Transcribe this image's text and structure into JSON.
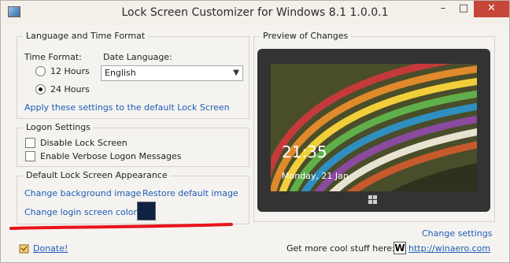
{
  "window": {
    "title": "Lock Screen Customizer for Windows 8.1 1.0.0.1",
    "minimize_glyph": "–",
    "maximize_glyph": "□",
    "close_glyph": "✕"
  },
  "language_time": {
    "group_title": "Language and Time Format",
    "time_format_label": "Time Format:",
    "options": [
      "12 Hours",
      "24 Hours"
    ],
    "selected_time_format": "24 Hours",
    "date_language_label": "Date Language:",
    "date_language_value": "English",
    "apply_link": "Apply these settings to the default Lock Screen"
  },
  "logon": {
    "group_title": "Logon Settings",
    "disable_lock_screen": "Disable Lock Screen",
    "disable_lock_screen_checked": false,
    "verbose_messages": "Enable Verbose Logon Messages",
    "verbose_messages_checked": false
  },
  "appearance": {
    "group_title": "Default Lock Screen Appearance",
    "change_background": "Change background image",
    "restore_default": "Restore default image",
    "change_login_color": "Change login screen color",
    "login_color": "#0f2242"
  },
  "preview": {
    "group_title": "Preview of Changes",
    "time": "21:35",
    "date": "Monday, 21 Jan"
  },
  "footer": {
    "change_settings": "Change settings",
    "donate": "Donate!",
    "more_stuff": "Get more cool stuff here:",
    "winaero_icon_letter": "W",
    "winaero_link": "http://winaero.com"
  },
  "colors": {
    "accent_link": "#1d5cb6",
    "annotation_red": "#e8141a",
    "close_button": "#c7463a"
  },
  "icons": {
    "app": "app-window-icon",
    "donate": "donate-icon",
    "winaero": "winaero-w-icon",
    "home": "windows-logo-icon"
  }
}
